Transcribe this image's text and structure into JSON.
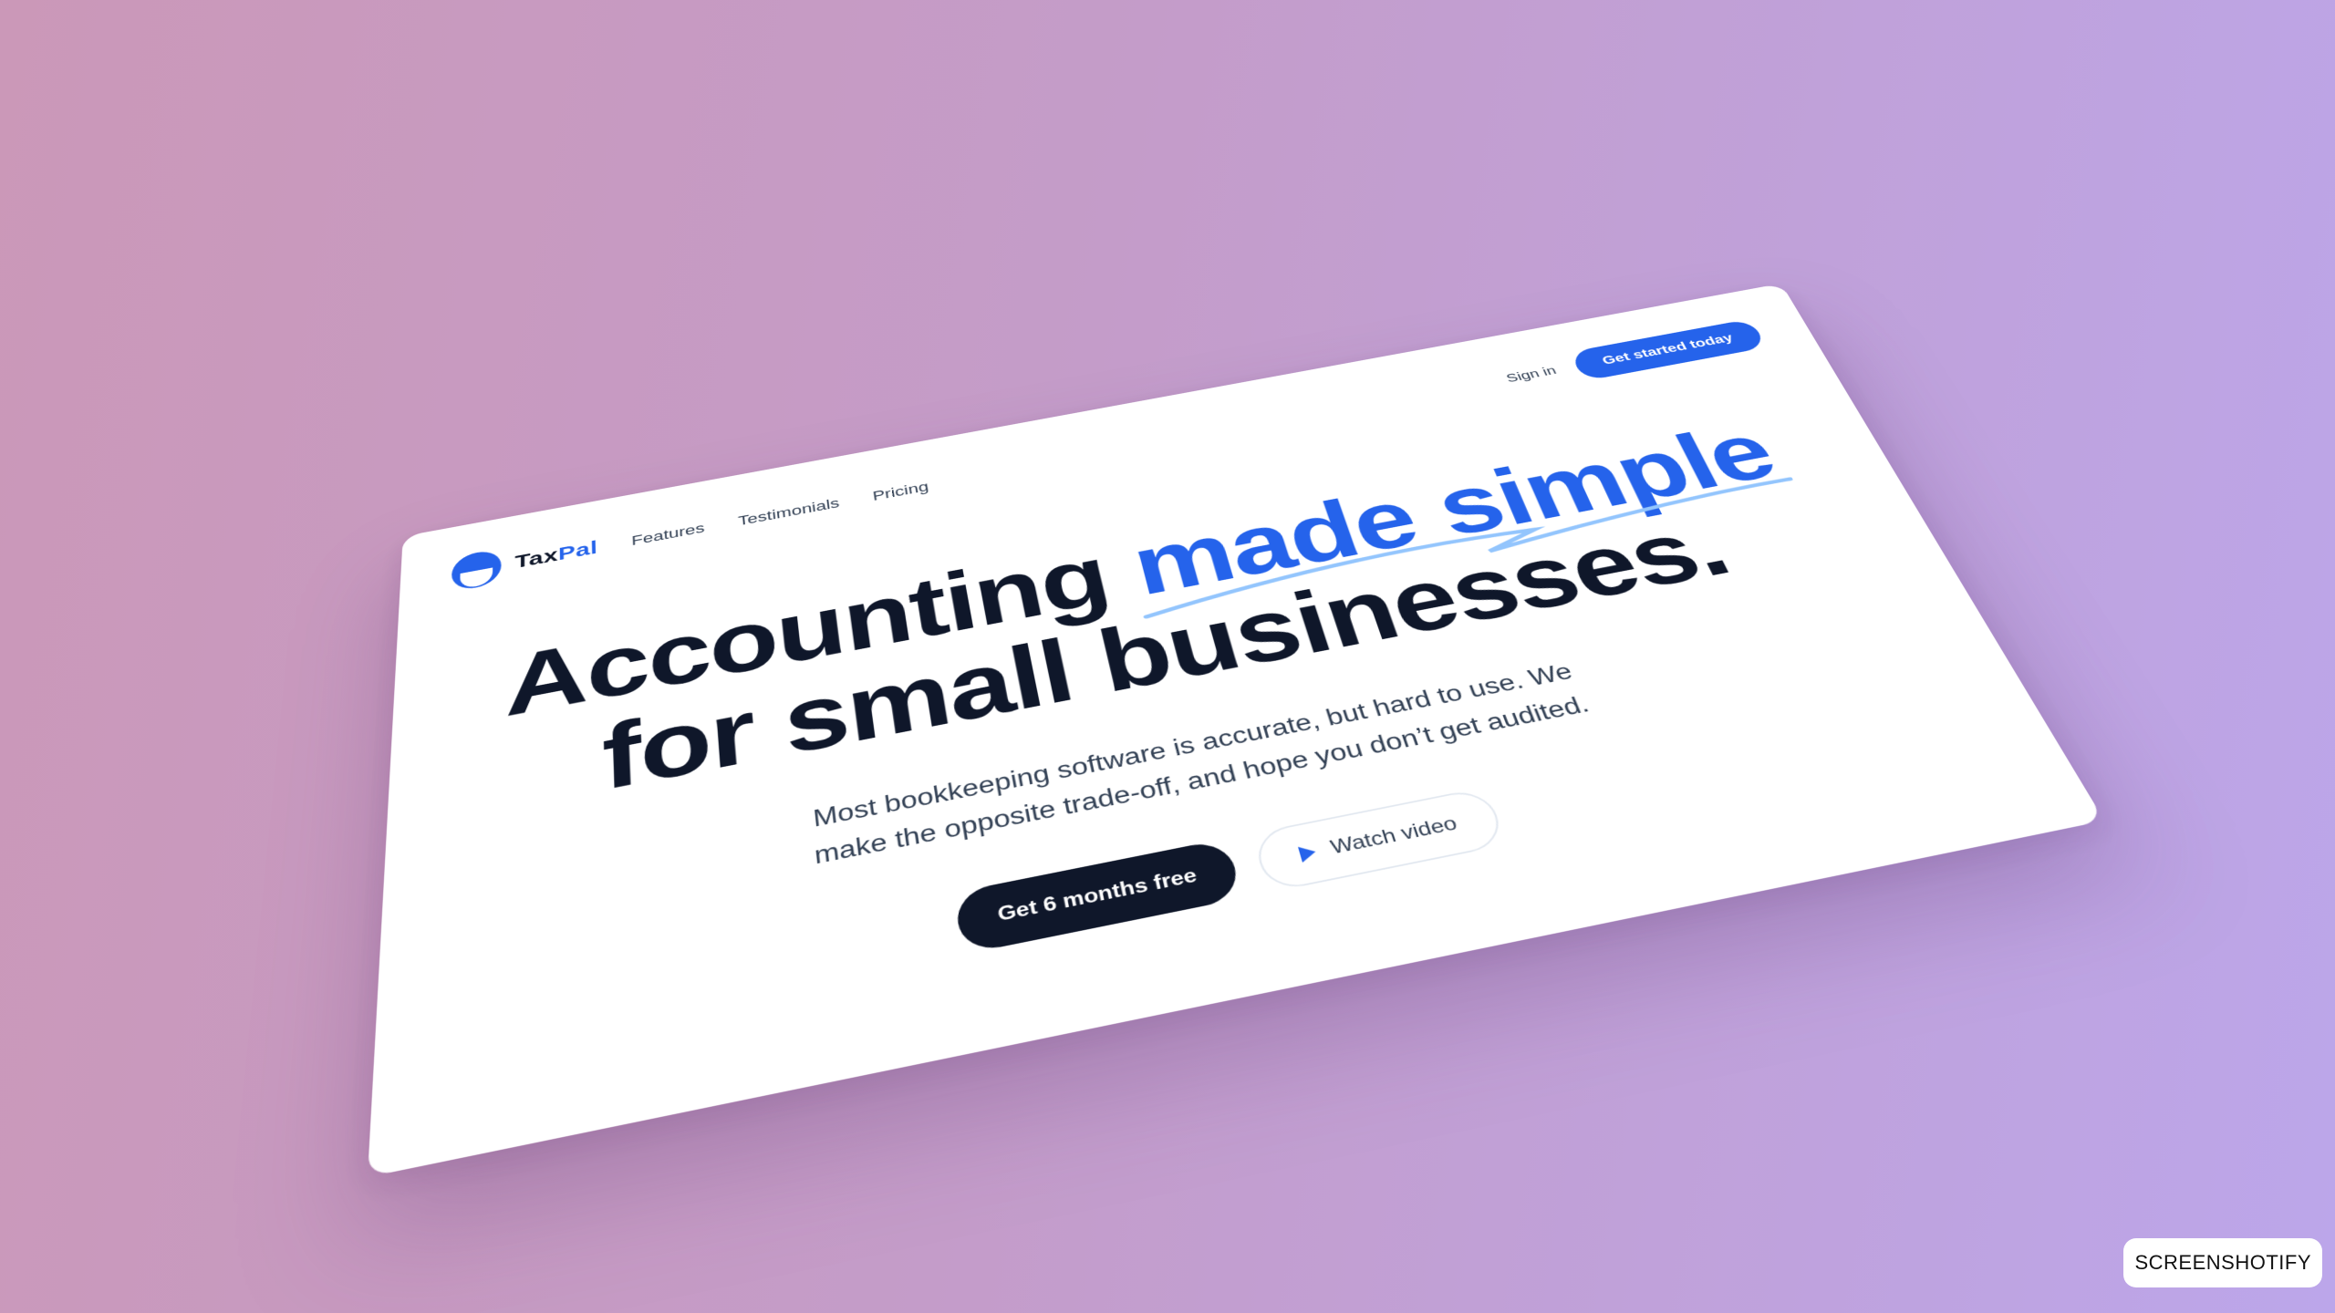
{
  "nav": {
    "brand_prefix": "Tax",
    "brand_suffix": "Pal",
    "links": [
      "Features",
      "Testimonials",
      "Pricing"
    ],
    "sign_in": "Sign in",
    "cta": "Get started today"
  },
  "hero": {
    "headline_start": "Accounting ",
    "headline_highlight": "made simple",
    "headline_end": "for small businesses.",
    "subtitle": "Most bookkeeping software is accurate, but hard to use. We make the opposite trade-off, and hope you don’t get audited.",
    "primary_button": "Get 6 months free",
    "secondary_button": "Watch video"
  },
  "watermark": "SCREENSHOTIFY",
  "colors": {
    "accent": "#2563eb",
    "dark": "#0f172a"
  }
}
